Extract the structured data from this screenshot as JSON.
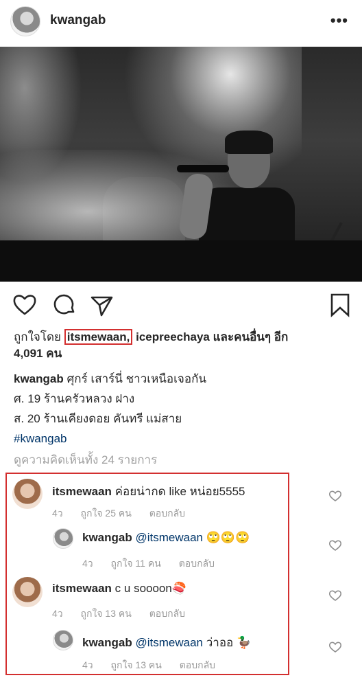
{
  "post": {
    "username": "kwangab",
    "more_icon": "more-horizontal-icon"
  },
  "likes": {
    "prefix": "ถูกใจโดย",
    "user1": "itsmewaan,",
    "user2": "icepreechaya",
    "and": "และคนอื่นๆ อีก",
    "count": "4,091 คน"
  },
  "caption": {
    "username": "kwangab",
    "line1": "ศุกร์ เสาร์นี่ ชาวเหนือเจอกัน",
    "line2": "ศ. 19 ร้านครัวหลวง ฝาง",
    "line3": "ส. 20 ร้านเคียงดอย คันทรี แม่สาย",
    "hashtag": "#kwangab"
  },
  "view_all": "ดูความคิดเห็นทั้ง 24 รายการ",
  "comments": [
    {
      "username": "itsmewaan",
      "text": "ค่อยน่ากด like หน่อย5555",
      "time": "4ว",
      "likes": "ถูกใจ 25 คน",
      "reply": "ตอบกลับ"
    },
    {
      "username": "kwangab",
      "mention": "@itsmewaan",
      "text": "🙄🙄🙄",
      "time": "4ว",
      "likes": "ถูกใจ 11 คน",
      "reply": "ตอบกลับ"
    },
    {
      "username": "itsmewaan",
      "text": "c u soooon🍣",
      "time": "4ว",
      "likes": "ถูกใจ 13 คน",
      "reply": "ตอบกลับ"
    },
    {
      "username": "kwangab",
      "mention": "@itsmewaan",
      "text": "ว่าออ 🦆",
      "time": "4ว",
      "likes": "ถูกใจ 13 คน",
      "reply": "ตอบกลับ"
    }
  ],
  "colors": {
    "highlight": "#d32f2f",
    "link": "#003569",
    "muted": "#999999"
  }
}
